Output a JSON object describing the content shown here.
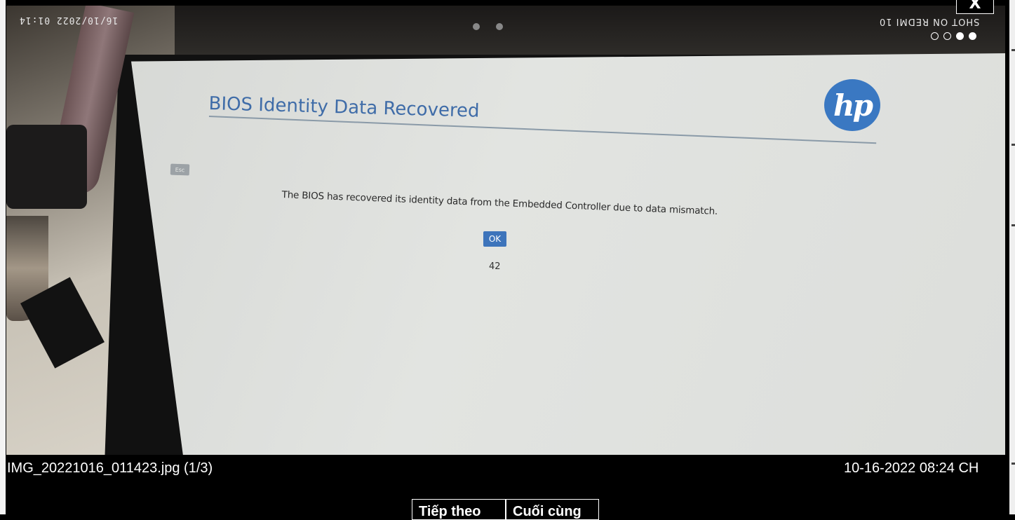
{
  "viewer": {
    "close_label": "X",
    "caption": {
      "filename": "IMG_20221016_011423.jpg (1/3)",
      "datetime": "10-16-2022 08:24 CH"
    },
    "nav": {
      "next_label": "Tiếp theo",
      "last_label": "Cuối cùng"
    }
  },
  "photo": {
    "watermark_date": "16/10/2022 01:14",
    "watermark_shot": "SHOT ON REDMI 10",
    "indicator_dots": [
      "empty",
      "empty",
      "filled",
      "filled"
    ],
    "bios_screen": {
      "title": "BIOS Identity Data Recovered",
      "logo_text": "hp",
      "esc_label": "Esc",
      "message": "The BIOS has recovered its identity data from the Embedded Controller due to data mismatch.",
      "ok_label": "OK",
      "code": "42",
      "colors": {
        "accent": "#3d74bb",
        "title": "#3f6ca8",
        "background": "#dfe1de"
      }
    }
  }
}
